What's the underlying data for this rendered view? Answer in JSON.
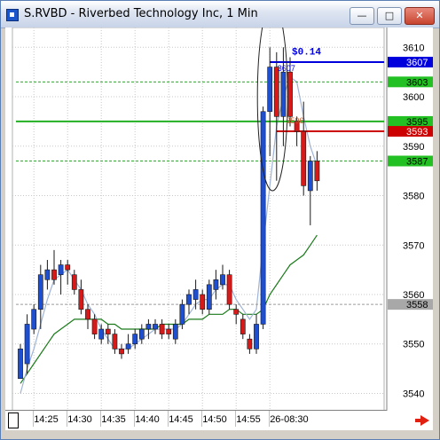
{
  "window": {
    "title": "S.RVBD - Riverbed Technology Inc, 1 Min",
    "minimize_label": "—",
    "maximize_label": "□",
    "close_label": "✕"
  },
  "colors": {
    "up_candle": "#1f4fd1",
    "down_candle": "#d61a1a",
    "fast_ma": "#9fb4d8",
    "slow_ma": "#1a7a1a",
    "level_solid_green": "#22b022",
    "level_dashed_green": "#2ca82c",
    "bid_line": "#0000dd",
    "ask_line": "#cc0000",
    "gray_line": "#9a9a9a"
  },
  "chart_data": {
    "type": "candlestick",
    "interval": "1 Min",
    "x_ticks": [
      "14:25",
      "14:30",
      "14:35",
      "14:40",
      "14:45",
      "14:50",
      "14:55",
      "26-08:30"
    ],
    "y_ticks": [
      3540,
      3550,
      3560,
      3570,
      3580,
      3590,
      3600,
      3610
    ],
    "ylim": [
      3536.5,
      3614
    ],
    "grid": true,
    "candles": [
      {
        "t": "14:23",
        "o": 3543,
        "h": 3550,
        "l": 3543,
        "c": 3549
      },
      {
        "t": "14:24",
        "o": 3546,
        "h": 3556,
        "l": 3544,
        "c": 3554
      },
      {
        "t": "14:25",
        "o": 3553,
        "h": 3558,
        "l": 3552,
        "c": 3557
      },
      {
        "t": "14:26",
        "o": 3557,
        "h": 3566,
        "l": 3553,
        "c": 3564
      },
      {
        "t": "14:27",
        "o": 3563,
        "h": 3567,
        "l": 3561,
        "c": 3565
      },
      {
        "t": "14:28",
        "o": 3565,
        "h": 3569,
        "l": 3562,
        "c": 3563
      },
      {
        "t": "14:29",
        "o": 3564,
        "h": 3567,
        "l": 3560,
        "c": 3566
      },
      {
        "t": "14:30",
        "o": 3566,
        "h": 3567,
        "l": 3562,
        "c": 3565
      },
      {
        "t": "14:31",
        "o": 3564,
        "h": 3565,
        "l": 3560,
        "c": 3561
      },
      {
        "t": "14:32",
        "o": 3561,
        "h": 3563,
        "l": 3556,
        "c": 3557
      },
      {
        "t": "14:33",
        "o": 3557,
        "h": 3558,
        "l": 3553,
        "c": 3555
      },
      {
        "t": "14:34",
        "o": 3555,
        "h": 3556,
        "l": 3551,
        "c": 3552
      },
      {
        "t": "14:35",
        "o": 3551,
        "h": 3554,
        "l": 3550,
        "c": 3553
      },
      {
        "t": "14:36",
        "o": 3553,
        "h": 3554,
        "l": 3550,
        "c": 3552
      },
      {
        "t": "14:37",
        "o": 3552,
        "h": 3553,
        "l": 3548,
        "c": 3549
      },
      {
        "t": "14:38",
        "o": 3549,
        "h": 3550,
        "l": 3547,
        "c": 3548
      },
      {
        "t": "14:39",
        "o": 3549,
        "h": 3552,
        "l": 3548,
        "c": 3550
      },
      {
        "t": "14:40",
        "o": 3550,
        "h": 3553,
        "l": 3549,
        "c": 3552
      },
      {
        "t": "14:41",
        "o": 3551,
        "h": 3554,
        "l": 3550,
        "c": 3553
      },
      {
        "t": "14:42",
        "o": 3553,
        "h": 3555,
        "l": 3551,
        "c": 3554
      },
      {
        "t": "14:43",
        "o": 3553,
        "h": 3555,
        "l": 3552,
        "c": 3554
      },
      {
        "t": "14:44",
        "o": 3554,
        "h": 3555,
        "l": 3551,
        "c": 3552
      },
      {
        "t": "14:45",
        "o": 3553,
        "h": 3554,
        "l": 3551,
        "c": 3552
      },
      {
        "t": "14:46",
        "o": 3551,
        "h": 3555,
        "l": 3550,
        "c": 3554
      },
      {
        "t": "14:47",
        "o": 3554,
        "h": 3559,
        "l": 3553,
        "c": 3558
      },
      {
        "t": "14:48",
        "o": 3558,
        "h": 3561,
        "l": 3556,
        "c": 3560
      },
      {
        "t": "14:49",
        "o": 3559,
        "h": 3563,
        "l": 3557,
        "c": 3561
      },
      {
        "t": "14:50",
        "o": 3560,
        "h": 3561,
        "l": 3556,
        "c": 3557
      },
      {
        "t": "14:51",
        "o": 3557,
        "h": 3563,
        "l": 3556,
        "c": 3562
      },
      {
        "t": "14:52",
        "o": 3561,
        "h": 3565,
        "l": 3559,
        "c": 3563
      },
      {
        "t": "14:53",
        "o": 3562,
        "h": 3566,
        "l": 3561,
        "c": 3564
      },
      {
        "t": "14:54",
        "o": 3564,
        "h": 3565,
        "l": 3557,
        "c": 3558
      },
      {
        "t": "14:55",
        "o": 3557,
        "h": 3558,
        "l": 3554,
        "c": 3556
      },
      {
        "t": "14:56",
        "o": 3555,
        "h": 3556,
        "l": 3551,
        "c": 3552
      },
      {
        "t": "14:57",
        "o": 3551,
        "h": 3552,
        "l": 3548,
        "c": 3549
      },
      {
        "t": "14:58",
        "o": 3549,
        "h": 3556,
        "l": 3548,
        "c": 3554
      },
      {
        "t": "14:59",
        "o": 3554,
        "h": 3598,
        "l": 3553,
        "c": 3597
      },
      {
        "t": "26-08:30",
        "o": 3597,
        "h": 3610,
        "l": 3588,
        "c": 3606
      },
      {
        "t": "26-08:31",
        "o": 3606,
        "h": 3609,
        "l": 3583,
        "c": 3596
      },
      {
        "t": "26-08:32",
        "o": 3596,
        "h": 3610,
        "l": 3590,
        "c": 3605
      },
      {
        "t": "26-08:33",
        "o": 3605,
        "h": 3608,
        "l": 3594,
        "c": 3596
      },
      {
        "t": "26-08:34",
        "o": 3595,
        "h": 3596,
        "l": 3590,
        "c": 3593
      },
      {
        "t": "26-08:35",
        "o": 3593,
        "h": 3599,
        "l": 3580,
        "c": 3582
      },
      {
        "t": "26-08:36",
        "o": 3581,
        "h": 3588,
        "l": 3574,
        "c": 3587
      },
      {
        "t": "26-08:37",
        "o": 3587,
        "h": 3589,
        "l": 3581,
        "c": 3583
      }
    ],
    "fast_ma": [
      3540,
      3545,
      3549,
      3554,
      3559,
      3563,
      3564,
      3565,
      3563,
      3561,
      3558,
      3556,
      3553,
      3551,
      3549,
      3549,
      3549,
      3550,
      3551,
      3552,
      3553,
      3553,
      3553,
      3553,
      3554,
      3556,
      3558,
      3559,
      3559,
      3561,
      3562,
      3562,
      3559,
      3557,
      3555,
      3557,
      3570,
      3582,
      3594,
      3600,
      3604,
      3603,
      3596,
      3590,
      3586
    ],
    "slow_ma": [
      3542,
      3544,
      3546,
      3548,
      3550,
      3552,
      3553,
      3554,
      3555,
      3555,
      3555,
      3555,
      3555,
      3554,
      3554,
      3553,
      3553,
      3553,
      3553,
      3553,
      3553,
      3554,
      3554,
      3554,
      3554,
      3555,
      3555,
      3555,
      3556,
      3556,
      3556,
      3557,
      3557,
      3556,
      3556,
      3556,
      3557,
      3560,
      3562,
      3564,
      3566,
      3567,
      3568,
      3570,
      3572
    ],
    "levels": [
      {
        "label": "3607",
        "value": 3607,
        "style": "solid",
        "color": "#0000dd",
        "badge_bg": "#0000dd",
        "badge_fg": "#ffffff",
        "inline": "3607"
      },
      {
        "label": "3603",
        "value": 3603,
        "style": "dashed",
        "color": "#2ca82c",
        "badge_bg": "#22c022",
        "badge_fg": "#000000",
        "inline": ""
      },
      {
        "label": "3595",
        "value": 3595,
        "style": "solid",
        "color": "#22b022",
        "badge_bg": "#22c022",
        "badge_fg": "#000000",
        "inline": "3596"
      },
      {
        "label": "3593",
        "value": 3593,
        "style": "solid",
        "color": "#cc0000",
        "badge_bg": "#cc0000",
        "badge_fg": "#ffffff",
        "inline": ""
      },
      {
        "label": "3587",
        "value": 3587,
        "style": "dashed",
        "color": "#2ca82c",
        "badge_bg": "#22c022",
        "badge_fg": "#000000",
        "inline": ""
      },
      {
        "label": "3558",
        "value": 3558,
        "style": "dashed",
        "color": "#9a9a9a",
        "badge_bg": "#a8a8a8",
        "badge_fg": "#000000",
        "inline": ""
      }
    ],
    "spread_label": "$0.14"
  }
}
